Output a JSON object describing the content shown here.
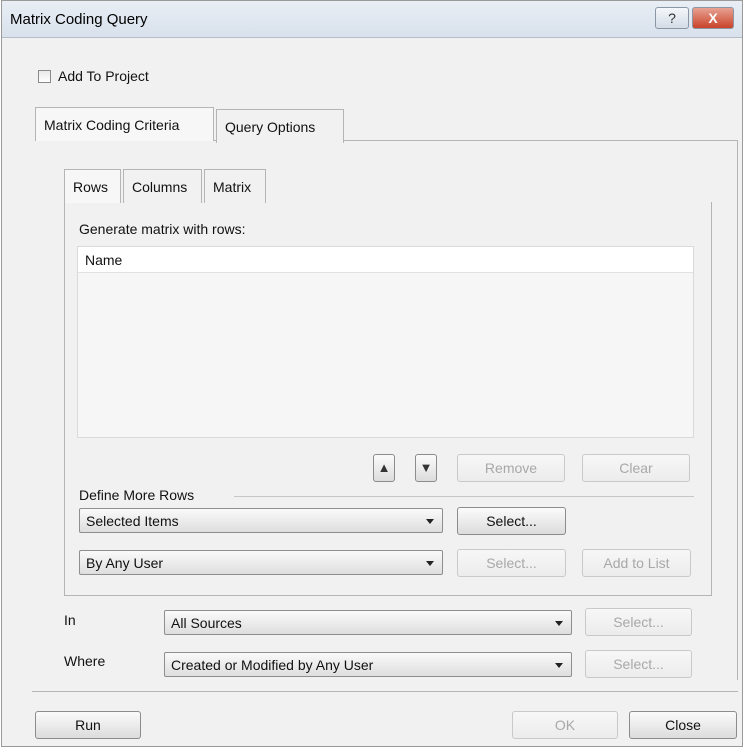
{
  "window": {
    "title": "Matrix Coding Query",
    "help_icon": "?",
    "close_icon": "X"
  },
  "add_to_project": {
    "label": "Add To Project",
    "checked": false
  },
  "outer_tabs": [
    {
      "label": "Matrix Coding Criteria",
      "active": true
    },
    {
      "label": "Query Options",
      "active": false
    }
  ],
  "inner_tabs": [
    {
      "label": "Rows",
      "active": true
    },
    {
      "label": "Columns",
      "active": false
    },
    {
      "label": "Matrix",
      "active": false
    }
  ],
  "rows_panel": {
    "heading": "Generate matrix with rows:",
    "list_column": "Name",
    "move_up_icon": "▲",
    "move_down_icon": "▼",
    "remove_label": "Remove",
    "clear_label": "Clear",
    "define_more_label": "Define More Rows",
    "items_combo": "Selected Items",
    "items_select_label": "Select...",
    "user_combo": "By Any User",
    "user_select_label": "Select...",
    "add_to_list_label": "Add to List"
  },
  "scope": {
    "in_label": "In",
    "in_value": "All Sources",
    "in_select_label": "Select...",
    "where_label": "Where",
    "where_value": "Created or Modified by Any User",
    "where_select_label": "Select..."
  },
  "footer": {
    "run_label": "Run",
    "ok_label": "OK",
    "close_label": "Close"
  }
}
